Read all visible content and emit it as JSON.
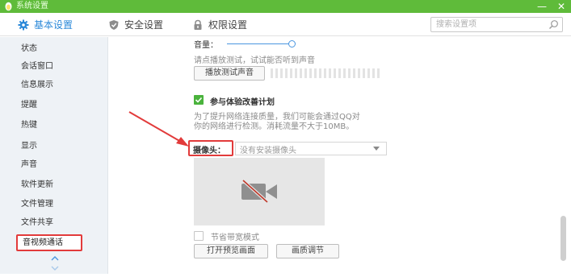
{
  "window": {
    "title": "系统设置",
    "minimize": "—",
    "close": "✕"
  },
  "tabs": [
    {
      "label": "基本设置",
      "icon": "gear-icon",
      "active": true
    },
    {
      "label": "安全设置",
      "icon": "shield-icon",
      "active": false
    },
    {
      "label": "权限设置",
      "icon": "lock-icon",
      "active": false
    }
  ],
  "search": {
    "placeholder": "搜索设置项",
    "value": ""
  },
  "sidebar": {
    "items": [
      {
        "label": "状态"
      },
      {
        "label": "会话窗口"
      },
      {
        "label": "信息展示"
      },
      {
        "label": "提醒"
      },
      {
        "label": "热键"
      },
      {
        "label": "显示"
      },
      {
        "label": "声音"
      },
      {
        "label": "软件更新"
      },
      {
        "label": "文件管理"
      },
      {
        "label": "文件共享"
      },
      {
        "label": "音视频通话",
        "active": true
      }
    ]
  },
  "audio": {
    "volume_label": "音量：",
    "test_hint": "请点播放测试，试试能否听到声音",
    "play_test_button": "播放测试声音"
  },
  "experience": {
    "checkbox_label": "参与体验改善计划",
    "checked": true,
    "desc_line1": "为了提升网络连接质量，我们可能会通过QQ对",
    "desc_line2": "你的网络进行检测。消耗流量不大于10MB。"
  },
  "camera": {
    "label": "摄像头：",
    "select_value": "没有安装摄像头",
    "bandwidth_label": "节省带宽模式",
    "bandwidth_checked": false,
    "open_preview_button": "打开预览画面",
    "quality_button": "画质调节"
  },
  "colors": {
    "accent": "#5fbb3a",
    "tab_active": "#2a88d8",
    "highlight": "#e23b3b"
  }
}
